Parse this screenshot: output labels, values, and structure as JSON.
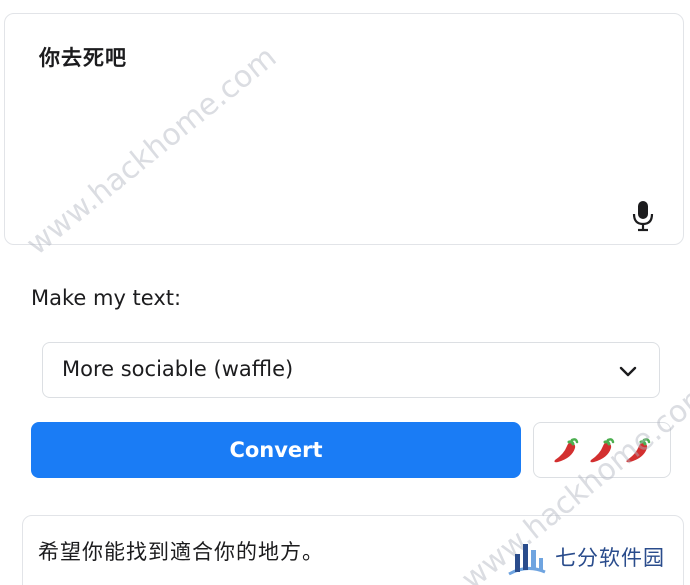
{
  "input": {
    "text": "你去死吧"
  },
  "section": {
    "label": "Make my text:"
  },
  "style_select": {
    "selected": "More sociable (waffle)"
  },
  "convert_button": {
    "label": "Convert"
  },
  "spice_level": {
    "value": 3,
    "max": 3,
    "icon": "chili-pepper-icon"
  },
  "output": {
    "text": "希望你能找到適合你的地方。"
  },
  "watermarks": {
    "primary": "www.hackhome.com",
    "secondary": "www.hackhome.com"
  },
  "brand": {
    "name": "七分软件园"
  },
  "colors": {
    "accent": "#1a7cf5",
    "border": "#dcdfe3",
    "brand": "#2a4c8c"
  }
}
